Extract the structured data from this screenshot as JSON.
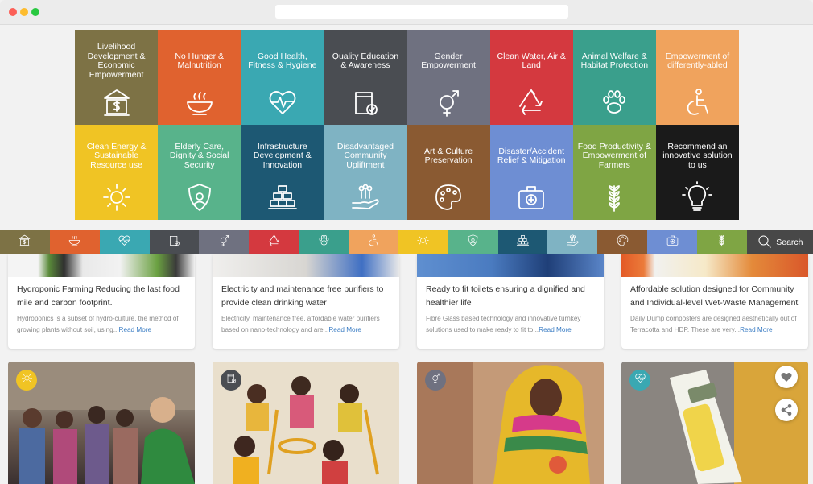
{
  "colors": {
    "livelihood": "#7d7245",
    "hunger": "#e0622f",
    "health": "#3aa8b2",
    "education": "#4a4d52",
    "gender": "#6f7180",
    "water": "#d4393f",
    "animal": "#3a9f8c",
    "disabled": "#f0a35d",
    "energy": "#f0c424",
    "elderly": "#58b38b",
    "infra": "#1d5873",
    "disadvantaged": "#7fb3c3",
    "art": "#8a5a32",
    "disaster": "#6e8ed3",
    "food": "#7fa544",
    "recommend": "#1a1a1a",
    "search": "#484848"
  },
  "categories": [
    {
      "label": "Livelihood Development & Economic Empowerment",
      "icon": "bank-icon",
      "color_key": "livelihood"
    },
    {
      "label": "No Hunger & Malnutrition",
      "icon": "bowl-icon",
      "color_key": "hunger"
    },
    {
      "label": "Good Health, Fitness & Hygiene",
      "icon": "heart-pulse-icon",
      "color_key": "health"
    },
    {
      "label": "Quality Education & Awareness",
      "icon": "book-check-icon",
      "color_key": "education"
    },
    {
      "label": "Gender Empowerment",
      "icon": "gender-icon",
      "color_key": "gender"
    },
    {
      "label": "Clean Water, Air & Land",
      "icon": "recycle-icon",
      "color_key": "water"
    },
    {
      "label": "Animal Welfare & Habitat Protection",
      "icon": "paw-icon",
      "color_key": "animal"
    },
    {
      "label": "Empowerment of differently-abled",
      "icon": "wheelchair-icon",
      "color_key": "disabled"
    },
    {
      "label": "Clean Energy & Sustainable Resource use",
      "icon": "sun-icon",
      "color_key": "energy"
    },
    {
      "label": "Elderly Care, Dignity & Social Security",
      "icon": "shield-icon",
      "color_key": "elderly"
    },
    {
      "label": "Infrastructure Development & Innovation",
      "icon": "bricks-icon",
      "color_key": "infra"
    },
    {
      "label": "Disadvantaged Community Upliftment",
      "icon": "hand-people-icon",
      "color_key": "disadvantaged"
    },
    {
      "label": "Art & Culture Preservation",
      "icon": "palette-icon",
      "color_key": "art"
    },
    {
      "label": "Disaster/Accident Relief & Mitigation",
      "icon": "firstaid-icon",
      "color_key": "disaster"
    },
    {
      "label": "Food Productivity & Empowerment of Farmers",
      "icon": "wheat-icon",
      "color_key": "food"
    },
    {
      "label": "Recommend an innovative solution to us",
      "icon": "bulb-icon",
      "color_key": "recommend"
    }
  ],
  "search": {
    "label": "Search"
  },
  "solutions": [
    {
      "title": "Hydroponic Farming Reducing the last food mile and carbon footprint.",
      "desc": "Hydroponics is a subset of hydro-culture, the method of growing plants without soil, using...",
      "more": "Read More"
    },
    {
      "title": "Electricity and maintenance free purifiers to provide clean drinking water",
      "desc": "Electricity, maintenance free, affordable water purifiers based on nano-technology and are...",
      "more": "Read More"
    },
    {
      "title": "Ready to fit toilets ensuring a dignified and healthier life",
      "desc": "Fibre Glass based technology and innovative turnkey solutions used to make ready to fit to...",
      "more": "Read More"
    },
    {
      "title": "Affordable solution designed for Community and Individual-level Wet-Waste Management",
      "desc": "Daily Dump composters are designed aesthetically out of Terracotta and HDP. These are very...",
      "more": "Read More"
    }
  ],
  "photo_cards": [
    {
      "badge_icon": "sun-icon",
      "badge_color_key": "energy"
    },
    {
      "badge_icon": "book-check-icon",
      "badge_color_key": "education"
    },
    {
      "badge_icon": "gender-icon",
      "badge_color_key": "gender"
    },
    {
      "badge_icon": "heart-pulse-icon",
      "badge_color_key": "health"
    }
  ]
}
